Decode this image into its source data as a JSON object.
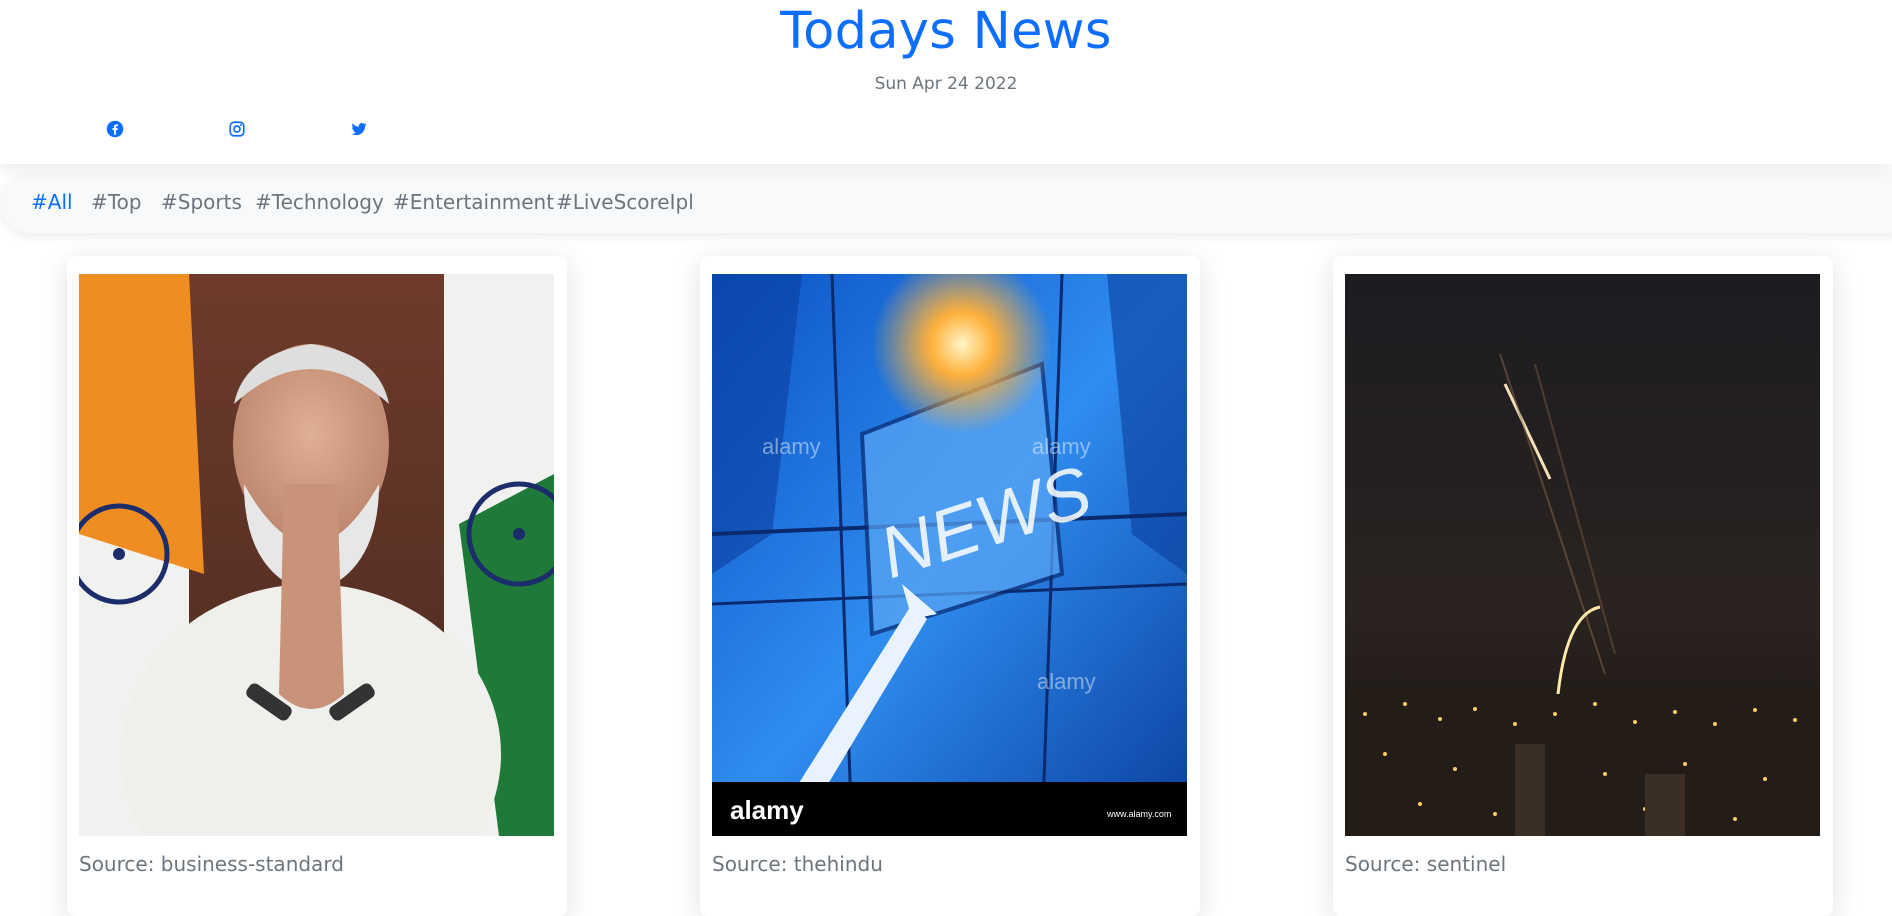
{
  "header": {
    "title": "Todays News",
    "date": "Sun Apr 24 2022"
  },
  "social": [
    {
      "icon": "facebook-icon"
    },
    {
      "icon": "instagram-icon"
    },
    {
      "icon": "twitter-icon"
    }
  ],
  "tags": [
    {
      "label": "#All",
      "active": true
    },
    {
      "label": "#Top",
      "active": false
    },
    {
      "label": "#Sports",
      "active": false
    },
    {
      "label": "#Technology",
      "active": false
    },
    {
      "label": "#Entertainment",
      "active": false
    },
    {
      "label": "#LiveScoreIpl",
      "active": false
    }
  ],
  "articles": [
    {
      "source": "Source: business-standard",
      "image_logo": ""
    },
    {
      "source": "Source: thehindu",
      "image_logo": "NEWS",
      "watermark": "alamy",
      "footer_logo": "alamy",
      "footer_url": "www.alamy.com"
    },
    {
      "source": "Source: sentinel",
      "image_logo": ""
    }
  ],
  "colors": {
    "accent": "#0d6efd",
    "muted": "#6c757d",
    "tagbar_bg": "#f8f9fa"
  }
}
